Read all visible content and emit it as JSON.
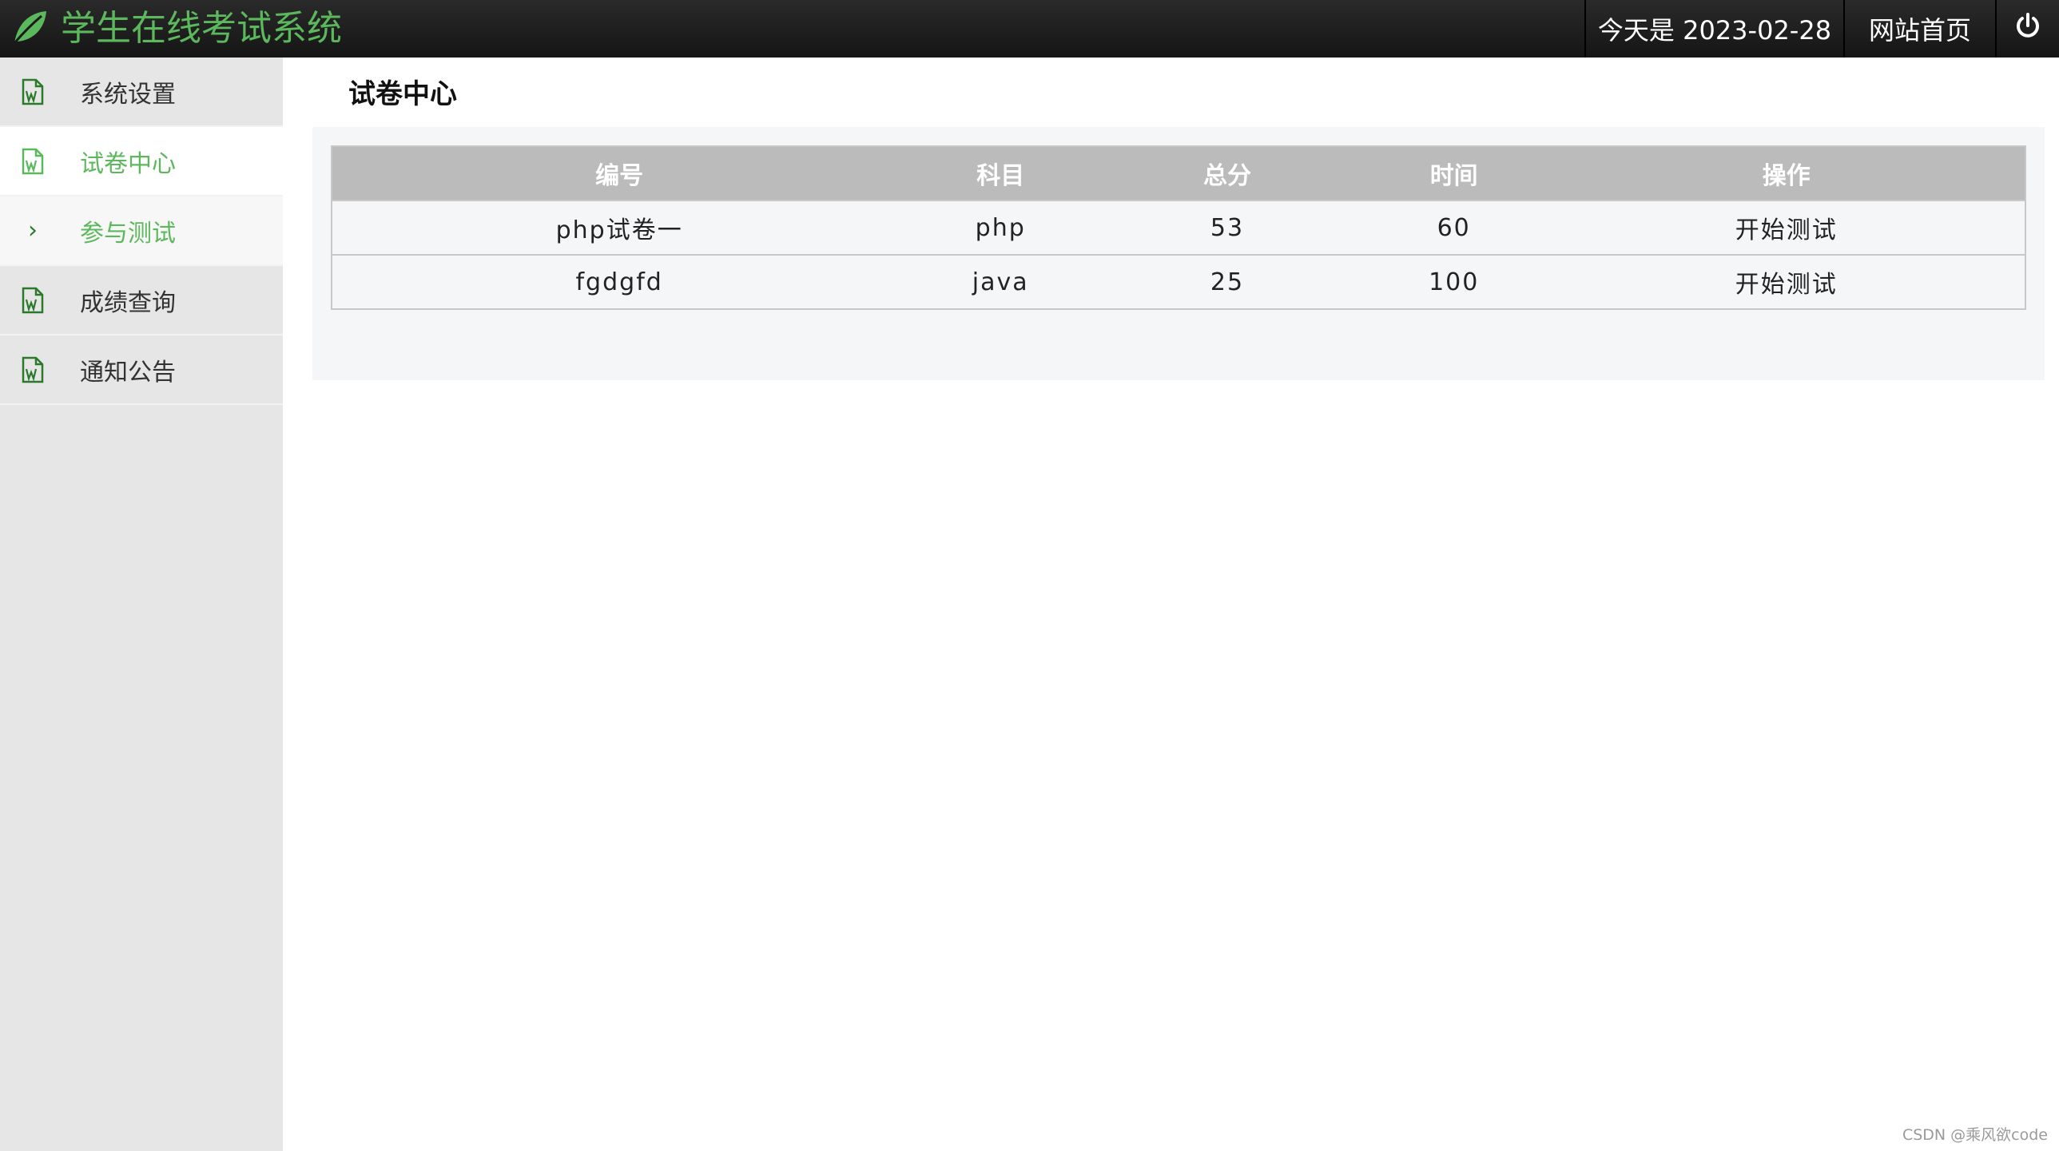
{
  "header": {
    "title": "学生在线考试系统",
    "date_text": "今天是 2023-02-28",
    "home_label": "网站首页",
    "brand_color": "#5cb85c"
  },
  "sidebar": {
    "items": [
      {
        "label": "系统设置",
        "icon": "document-icon"
      },
      {
        "label": "试卷中心",
        "icon": "document-icon",
        "active": true
      },
      {
        "label": "参与测试",
        "icon": "chevron-right-icon",
        "sub": true
      },
      {
        "label": "成绩查询",
        "icon": "document-icon"
      },
      {
        "label": "通知公告",
        "icon": "document-icon"
      }
    ]
  },
  "main": {
    "title": "试卷中心",
    "table": {
      "headers": [
        "编号",
        "科目",
        "总分",
        "时间",
        "操作"
      ],
      "rows": [
        [
          "php试卷一",
          "php",
          "53",
          "60",
          "开始测试"
        ],
        [
          "fgdgfd",
          "java",
          "25",
          "100",
          "开始测试"
        ]
      ]
    }
  },
  "watermark": "CSDN @乘风欲code"
}
